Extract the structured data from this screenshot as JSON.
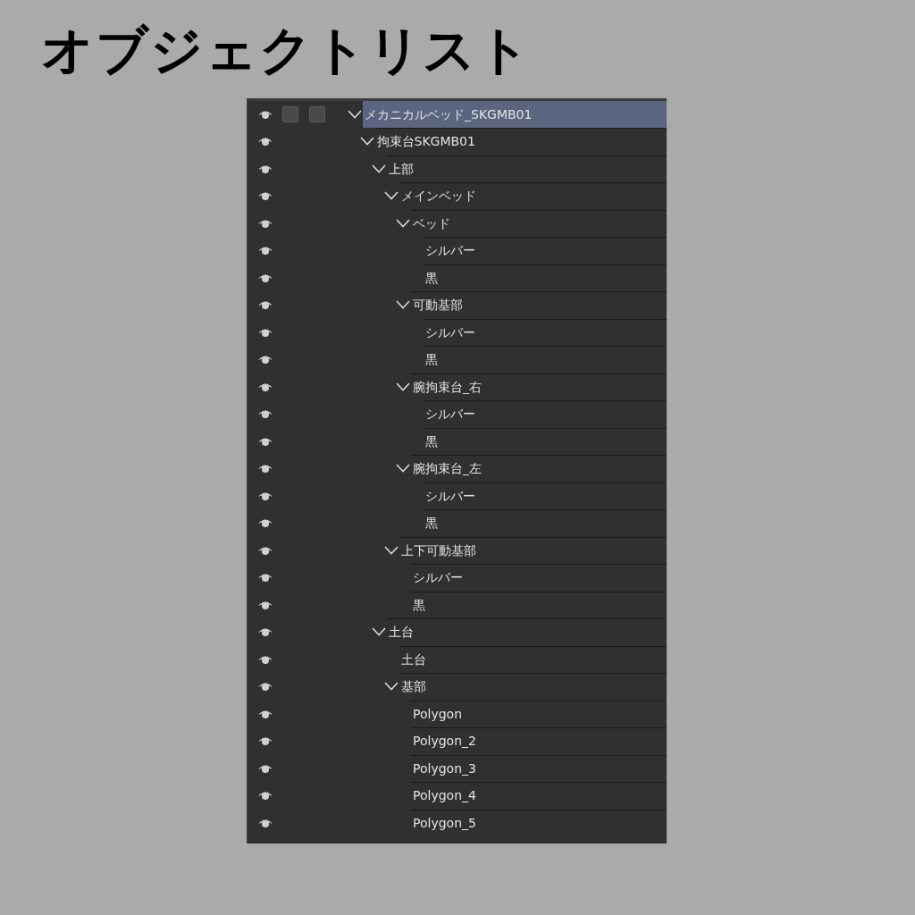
{
  "heading": "オブジェクトリスト",
  "tree": [
    {
      "label": "メカニカルベッド_SKGMB01",
      "toggles": [
        {
          "checked": false
        },
        {
          "checked": false
        }
      ],
      "visible": true,
      "selected": true,
      "expanded": true,
      "children": [
        {
          "label": "拘束台SKGMB01",
          "visible": true,
          "selected": false,
          "expanded": true,
          "children": [
            {
              "label": "上部",
              "visible": true,
              "selected": false,
              "expanded": true,
              "children": [
                {
                  "label": "メインベッド",
                  "visible": true,
                  "selected": false,
                  "expanded": true,
                  "children": [
                    {
                      "label": "ベッド",
                      "visible": true,
                      "selected": false,
                      "expanded": true,
                      "children": [
                        {
                          "label": "シルバー",
                          "visible": true,
                          "selected": false
                        },
                        {
                          "label": "黒",
                          "visible": true,
                          "selected": false
                        }
                      ]
                    },
                    {
                      "label": "可動基部",
                      "visible": true,
                      "selected": false,
                      "expanded": true,
                      "children": [
                        {
                          "label": "シルバー",
                          "visible": true,
                          "selected": false
                        },
                        {
                          "label": "黒",
                          "visible": true,
                          "selected": false
                        }
                      ]
                    },
                    {
                      "label": "腕拘束台_右",
                      "visible": true,
                      "selected": false,
                      "expanded": true,
                      "children": [
                        {
                          "label": "シルバー",
                          "visible": true,
                          "selected": false
                        },
                        {
                          "label": "黒",
                          "visible": true,
                          "selected": false
                        }
                      ]
                    },
                    {
                      "label": "腕拘束台_左",
                      "visible": true,
                      "selected": false,
                      "expanded": true,
                      "children": [
                        {
                          "label": "シルバー",
                          "visible": true,
                          "selected": false
                        },
                        {
                          "label": "黒",
                          "visible": true,
                          "selected": false
                        }
                      ]
                    }
                  ]
                },
                {
                  "label": "上下可動基部",
                  "visible": true,
                  "selected": false,
                  "expanded": true,
                  "children": [
                    {
                      "label": "シルバー",
                      "visible": true,
                      "selected": false
                    },
                    {
                      "label": "黒",
                      "visible": true,
                      "selected": false
                    }
                  ]
                }
              ]
            },
            {
              "label": "土台",
              "visible": true,
              "selected": false,
              "expanded": true,
              "children": [
                {
                  "label": "土台",
                  "visible": true,
                  "selected": false
                },
                {
                  "label": "基部",
                  "visible": true,
                  "selected": false,
                  "expanded": true,
                  "children": [
                    {
                      "label": "Polygon",
                      "visible": true,
                      "selected": false
                    },
                    {
                      "label": "Polygon_2",
                      "visible": true,
                      "selected": false
                    },
                    {
                      "label": "Polygon_3",
                      "visible": true,
                      "selected": false
                    },
                    {
                      "label": "Polygon_4",
                      "visible": true,
                      "selected": false
                    },
                    {
                      "label": "Polygon_5",
                      "visible": true,
                      "selected": false
                    }
                  ]
                }
              ]
            }
          ]
        }
      ]
    }
  ]
}
